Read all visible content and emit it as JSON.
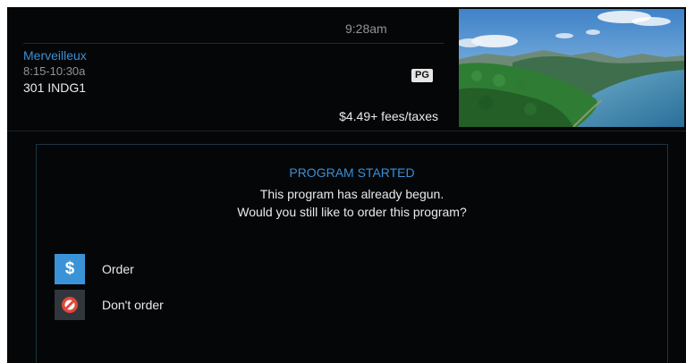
{
  "header": {
    "clock": "9:28am",
    "program_title": "Merveilleux",
    "program_time": "8:15-10:30a",
    "program_channel": "301 INDG1",
    "rating": "PG",
    "price": "$4.49+ fees/taxes"
  },
  "dialog": {
    "title": "PROGRAM STARTED",
    "message_line1": "This program has already begun.",
    "message_line2": "Would you still like to order this program?",
    "options": [
      {
        "label": "Order",
        "icon": "dollar-icon",
        "icon_glyph": "$"
      },
      {
        "label": "Don't order",
        "icon": "prohibited-icon"
      }
    ]
  },
  "colors": {
    "background": "#050607",
    "accent_blue": "#3b8fd6",
    "secondary_text": "#8e949a",
    "primary_text": "#e8eaec",
    "prohibited_red": "#e0483a"
  }
}
